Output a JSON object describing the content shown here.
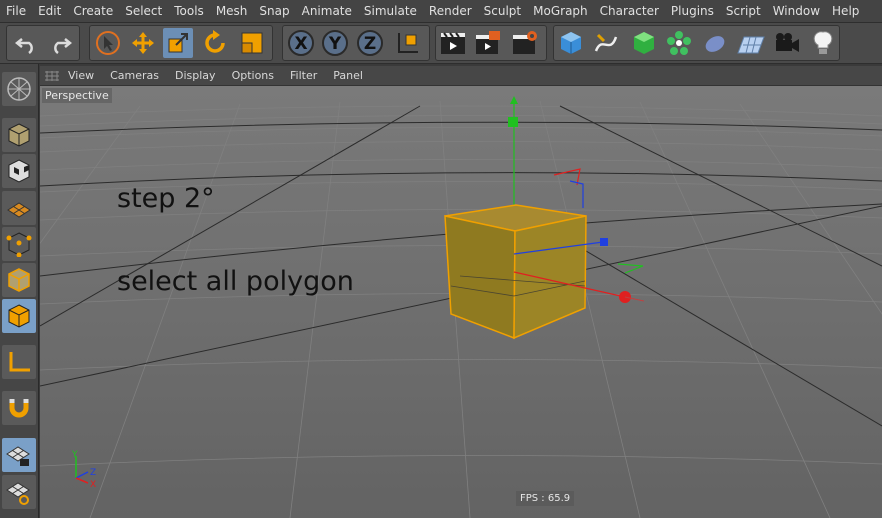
{
  "menu": [
    "File",
    "Edit",
    "Create",
    "Select",
    "Tools",
    "Mesh",
    "Snap",
    "Animate",
    "Simulate",
    "Render",
    "Sculpt",
    "MoGraph",
    "Character",
    "Plugins",
    "Script",
    "Window",
    "Help"
  ],
  "viewport_menu": [
    "View",
    "Cameras",
    "Display",
    "Options",
    "Filter",
    "Panel"
  ],
  "viewport_label": "Perspective",
  "overlay": {
    "step": "step 2°",
    "select": "select all polygon"
  },
  "fps": "FPS : 65.9",
  "colors": {
    "accent": "#f0a000",
    "selection": "#6c8fb6",
    "axis_x": "#e02020",
    "axis_y": "#20c020",
    "axis_z": "#2040e0"
  },
  "icons": {
    "toolbar": [
      "undo-icon",
      "redo-icon",
      "select-arrow-icon",
      "move-icon",
      "scale-icon",
      "rotate-icon",
      "last-tool-icon",
      "x-axis-icon",
      "y-axis-icon",
      "z-axis-icon",
      "coordinate-system-icon",
      "render-view-icon",
      "render-picture-viewer-icon",
      "render-settings-icon",
      "cube-primitive-icon",
      "pen-spline-icon",
      "nurbs-icon",
      "array-icon",
      "deformer-icon",
      "floor-icon",
      "camera-icon",
      "light-icon"
    ],
    "sidebar": [
      "make-editable-icon",
      "model-mode-icon",
      "texture-mode-icon",
      "workplane-icon",
      "points-mode-icon",
      "edges-mode-icon",
      "polygons-mode-icon",
      "axis-mode-icon",
      "magnet-snap-icon",
      "lock-workplane-icon",
      "workplane-snap-icon"
    ]
  }
}
